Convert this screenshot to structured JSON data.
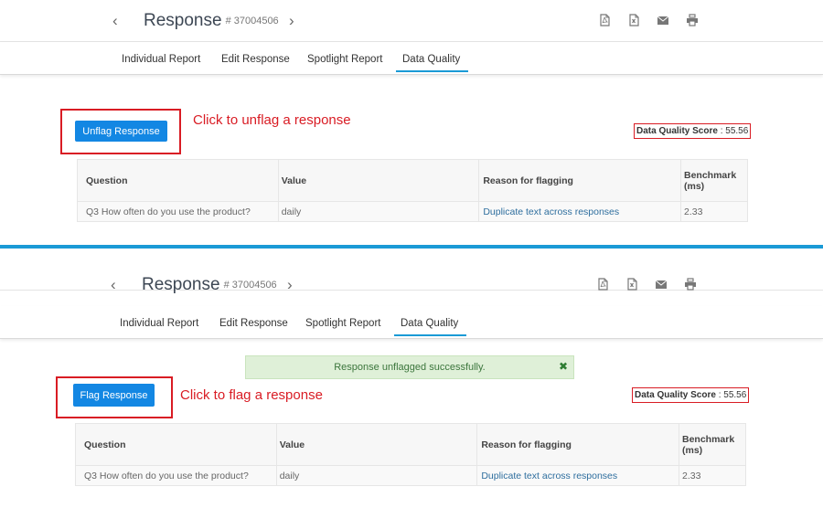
{
  "header": {
    "prev_icon": "‹",
    "next_icon": "›",
    "title": "Response",
    "response_id": "# 37004506",
    "toolbar_icons": [
      "pdf-icon",
      "excel-icon",
      "email-icon",
      "print-icon"
    ]
  },
  "tabs": [
    {
      "label": "Individual Report"
    },
    {
      "label": "Edit Response"
    },
    {
      "label": "Spotlight Report"
    },
    {
      "label": "Data Quality",
      "active": true
    }
  ],
  "top": {
    "button_label": "Unflag Response",
    "callout": "Click to unflag a response"
  },
  "bottom": {
    "button_label": "Flag Response",
    "callout": "Click to flag a response",
    "toast": "Response unflagged successfully.",
    "toast_close": "✖"
  },
  "score": {
    "label": "Data Quality Score",
    "separator": " : ",
    "value": "55.56"
  },
  "table": {
    "headers": [
      "Question",
      "Value",
      "Reason for flagging",
      "Benchmark (ms)"
    ],
    "rows": [
      [
        "Q3 How often do you use the product?",
        "daily",
        "Duplicate text across responses",
        "2.33"
      ]
    ]
  },
  "colors": {
    "accent": "#1387e3",
    "callout_red": "#d91c24",
    "divider_blue": "#1a9ad6",
    "toast_bg": "#dff0d8"
  }
}
